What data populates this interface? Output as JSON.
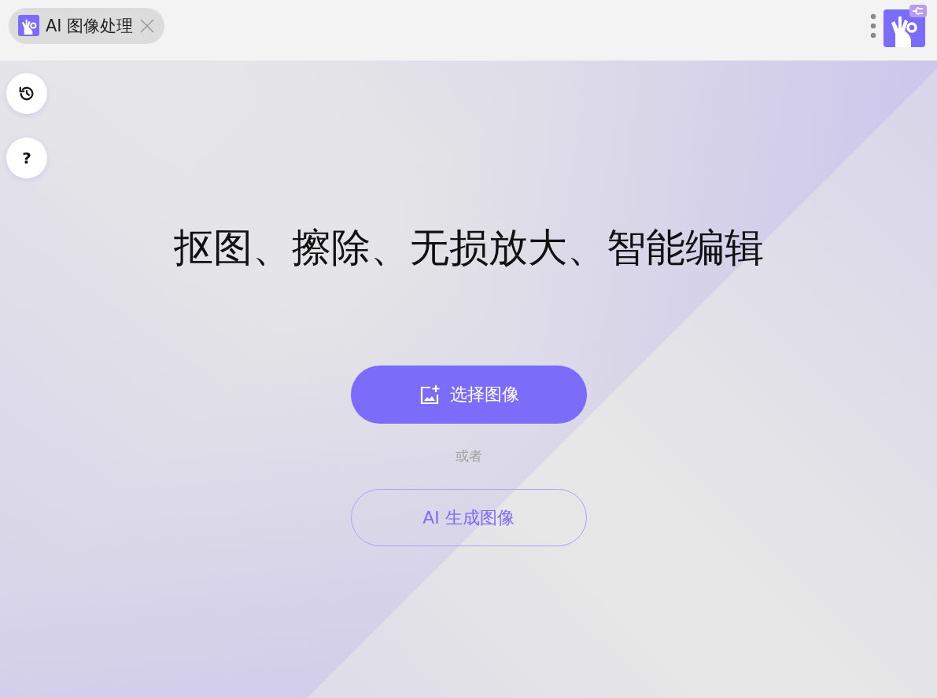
{
  "tab": {
    "label": "AI 图像处理"
  },
  "side_buttons": [
    {
      "kind": "history"
    },
    {
      "kind": "help",
      "label": "?"
    }
  ],
  "headline": "抠图、擦除、无损放大、智能编辑",
  "primary_button": {
    "label": "选择图像"
  },
  "divider_text": "或者",
  "secondary_button": {
    "label": "AI 生成图像"
  }
}
